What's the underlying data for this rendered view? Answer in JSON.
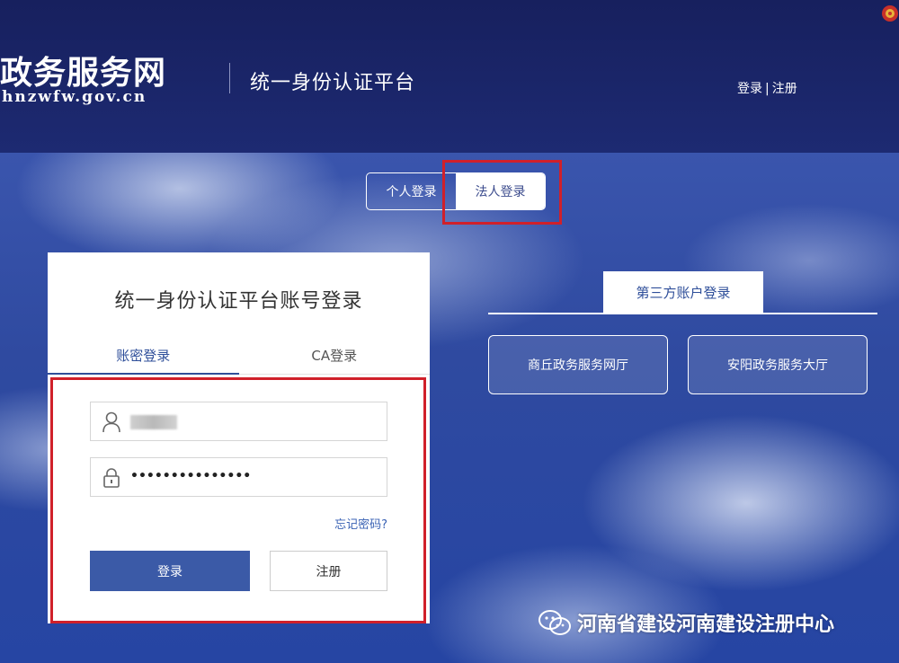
{
  "header": {
    "logo_text": "政务服务网",
    "logo_url": "hnzwfw.gov.cn",
    "platform_title": "统一身份认证平台",
    "login_link": "登录",
    "separator": "|",
    "register_link": "注册"
  },
  "login_type": {
    "personal": "个人登录",
    "legal": "法人登录",
    "active": "法人登录"
  },
  "login_card": {
    "title": "统一身份认证平台账号登录",
    "tabs": [
      {
        "label": "账密登录",
        "active": true
      },
      {
        "label": "CA登录",
        "active": false
      }
    ],
    "password_value": "•••••••••••••••",
    "forgot_password": "忘记密码?",
    "login_button": "登录",
    "register_button": "注册"
  },
  "third_party": {
    "tab_label": "第三方账户登录",
    "options": [
      "商丘政务服务网厅",
      "安阳政务服务大厅"
    ]
  },
  "watermark": {
    "text": "河南省建设河南建设注册中心"
  },
  "colors": {
    "header_bg": "#1b2568",
    "accent": "#3b5aa7",
    "highlight": "#d0202a"
  }
}
